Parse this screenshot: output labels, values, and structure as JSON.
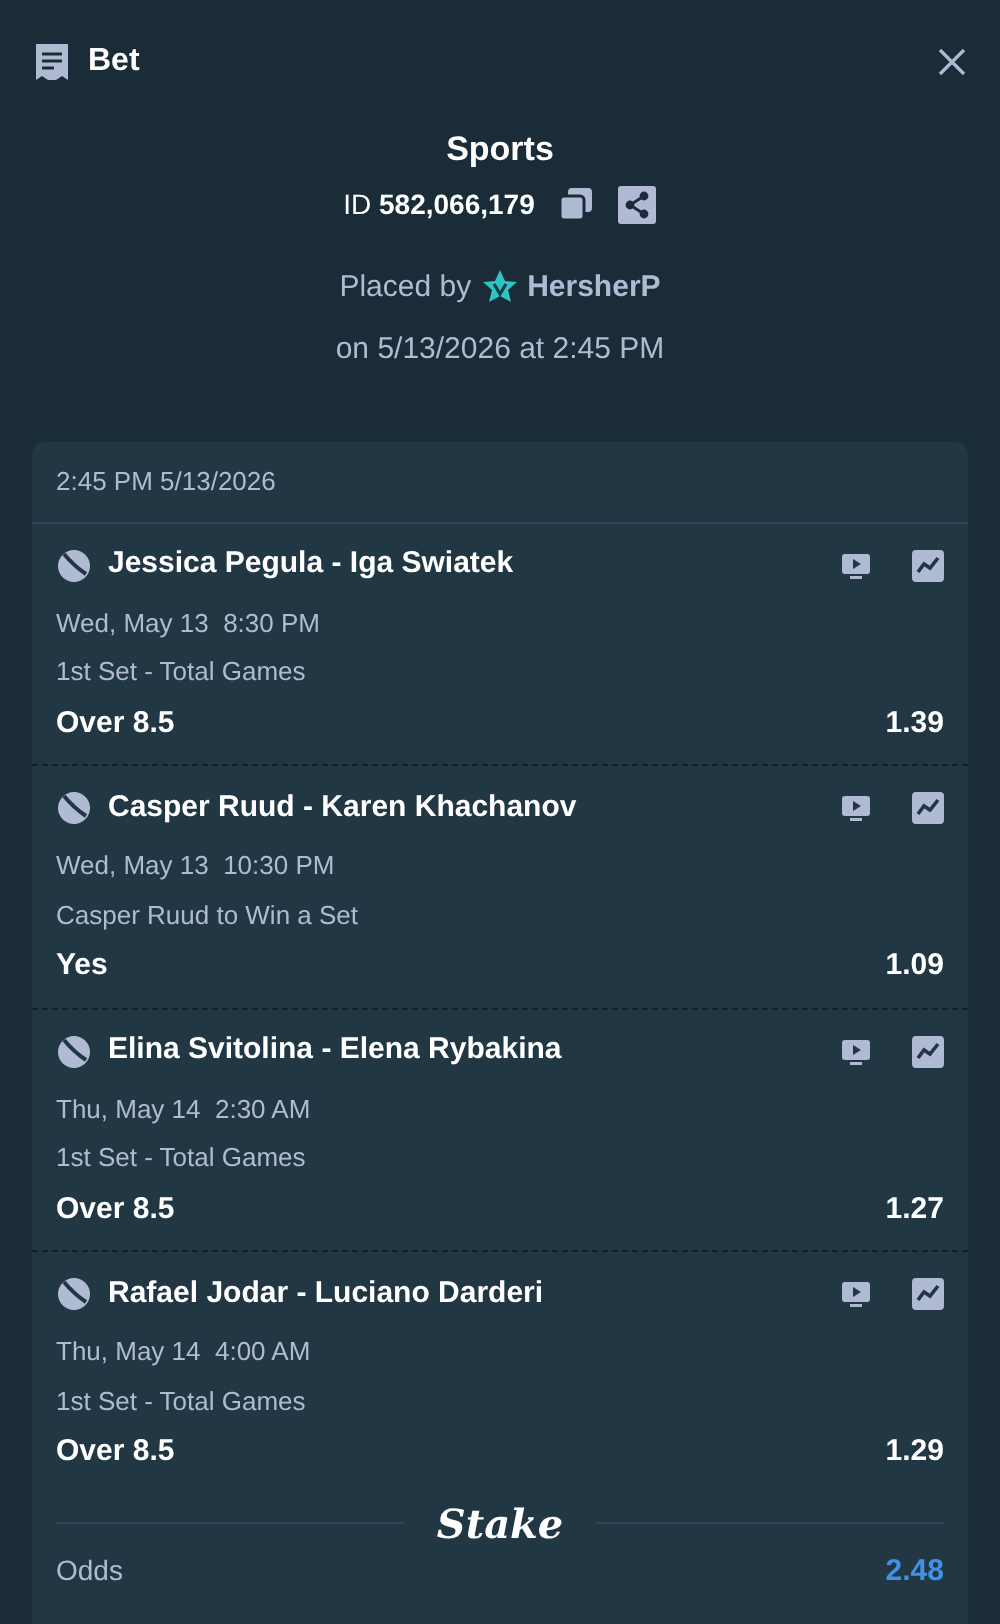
{
  "header": {
    "title": "Bet"
  },
  "bet": {
    "category": "Sports",
    "id_label": "ID",
    "id_value": "582,066,179",
    "placed_by_label": "Placed by",
    "user": "HersherP",
    "placed_on": "on 5/13/2026 at 2:45 PM"
  },
  "slip": {
    "timestamp": "2:45 PM 5/13/2026",
    "legs": [
      {
        "match": "Jessica Pegula - Iga Swiatek",
        "date": "Wed, May 13  8:30 PM",
        "market": "1st Set - Total Games",
        "selection": "Over 8.5",
        "odds": "1.39"
      },
      {
        "match": "Casper Ruud - Karen Khachanov",
        "date": "Wed, May 13  10:30 PM",
        "market": "Casper Ruud to Win a Set",
        "selection": "Yes",
        "odds": "1.09"
      },
      {
        "match": "Elina Svitolina - Elena Rybakina",
        "date": "Thu, May 14  2:30 AM",
        "market": "1st Set - Total Games",
        "selection": "Over 8.5",
        "odds": "1.27"
      },
      {
        "match": "Rafael Jodar - Luciano Darderi",
        "date": "Thu, May 14  4:00 AM",
        "market": "1st Set - Total Games",
        "selection": "Over 8.5",
        "odds": "1.29"
      }
    ],
    "brand": "Stake",
    "odds_label": "Odds",
    "odds_value": "2.48"
  }
}
